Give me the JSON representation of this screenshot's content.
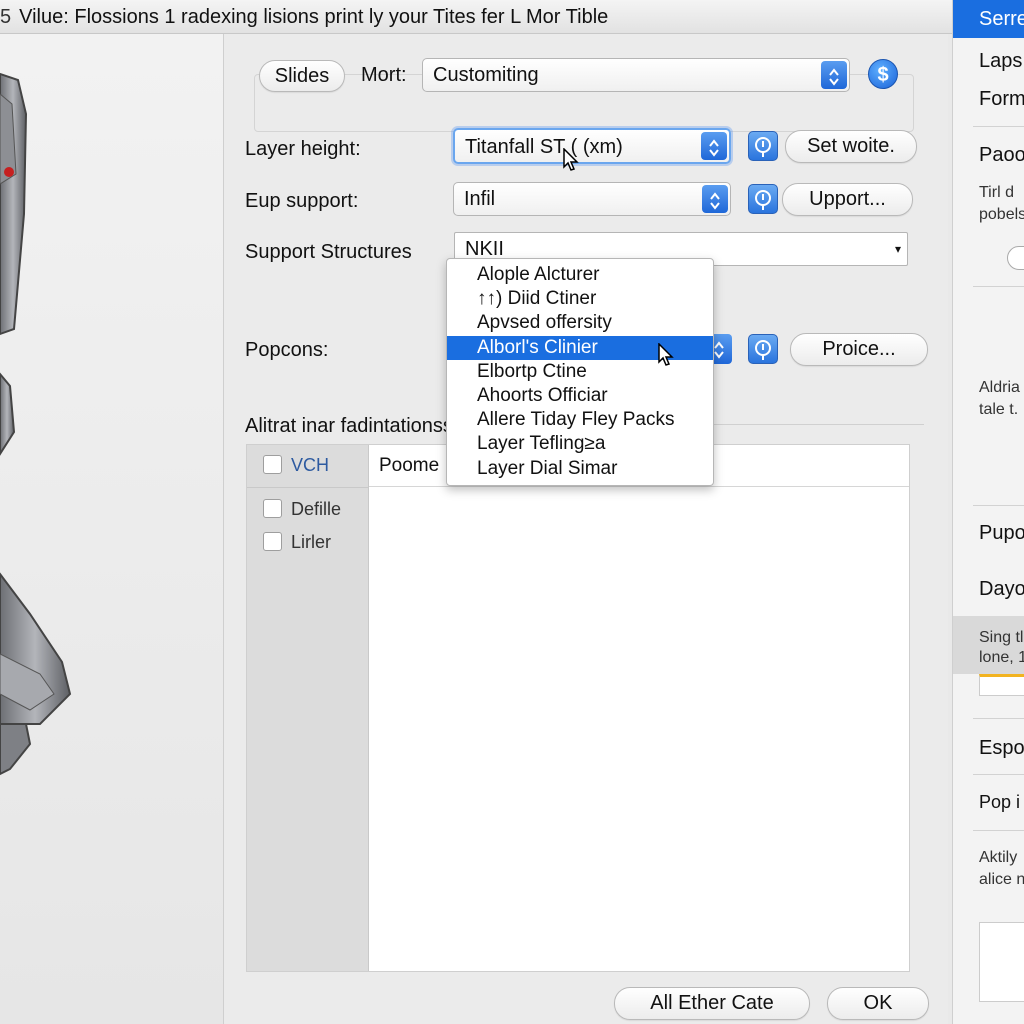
{
  "window": {
    "title_prefix": "5",
    "title": "Vilue: Flossions 1 radexing lisions print ly your Tites fer L Mor Tible"
  },
  "tabs": {
    "slides_label": "Slides",
    "mort_label": "Mort:",
    "mort_value": "Customiting",
    "dollar_symbol": "$"
  },
  "form": {
    "layer_height_label": "Layer height:",
    "layer_height_value": "Titanfall ST ( (xm)",
    "set_button": "Set woite.",
    "eup_support_label": "Eup support:",
    "eup_support_value": "Infil",
    "upport_button": "Upport...",
    "support_structures_label": "Support Structures",
    "support_structures_value": "NKII",
    "popcons_label": "Popcons:",
    "price_button": "Proice..."
  },
  "dropdown": {
    "items": [
      "Alople Alcturer",
      "↑↑) Diid Ctiner",
      "Apvsed offersity",
      "Alborl's Clinier",
      "Elbortp Ctine",
      "Ahoorts Officiar",
      "Allere Tiday Fley Packs",
      "Layer Tefling≥a",
      "Layer Dial Simar"
    ],
    "selected_index": 3
  },
  "section": {
    "heading": "Alitrat inar fadintationss",
    "left_items": [
      "VCH",
      "Defille",
      "Lirler"
    ],
    "column_header": "Poome"
  },
  "footer": {
    "secondary_button": "All Ether Cate",
    "ok_button": "OK"
  },
  "sidebar": {
    "header": "Serre",
    "laps": "Laps",
    "form": "Form",
    "paco": "Paoo",
    "note_lines": [
      "Tirl d",
      "pobels"
    ],
    "aldria_lines": [
      "Aldria",
      "tale t."
    ],
    "pupo": "Pupo",
    "dayo": "Dayo",
    "sing_lines": [
      "Sing tl",
      "lone, 1"
    ],
    "espo": "Espo",
    "pop": "Pop i",
    "aktily_lines": [
      "Aktily",
      "alice n"
    ]
  },
  "colors": {
    "accent": "#1a6ee0",
    "window_bg": "#ebebeb"
  }
}
